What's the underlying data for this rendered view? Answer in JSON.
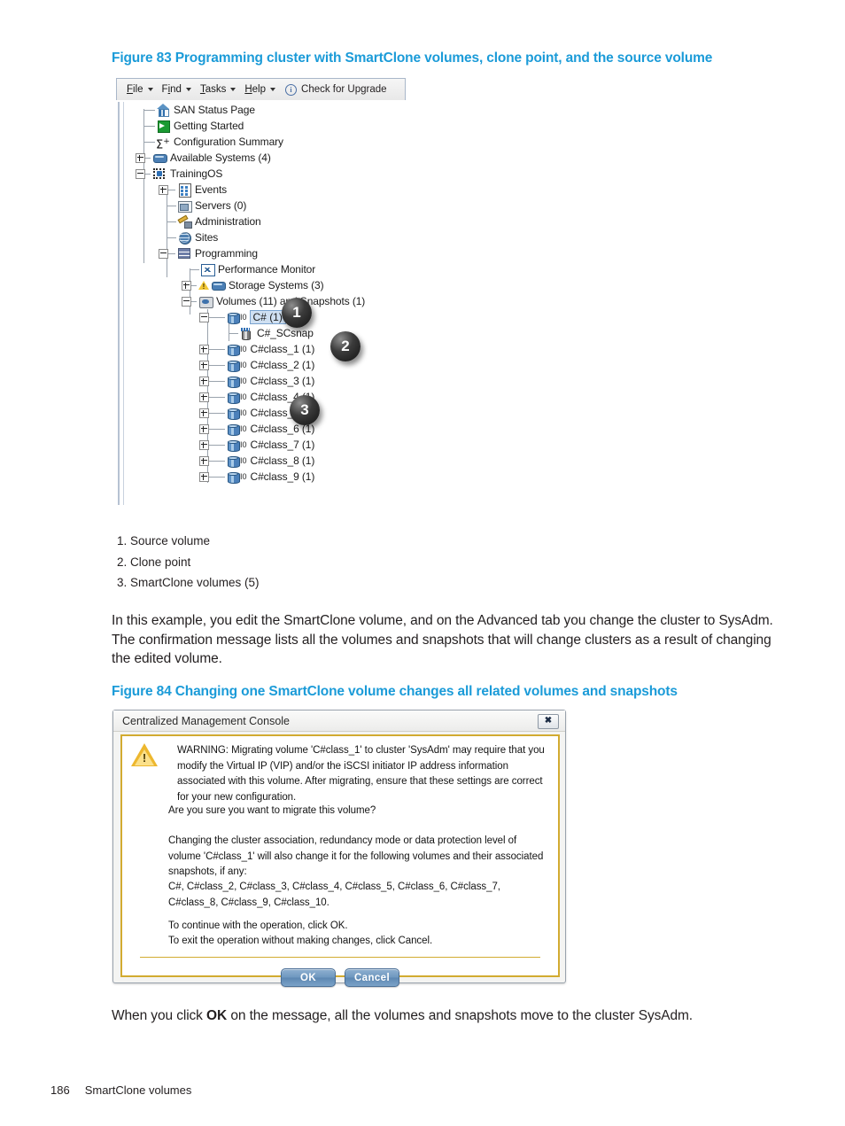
{
  "figure83": {
    "caption": "Figure 83 Programming cluster with SmartClone volumes, clone point, and the source volume",
    "menubar": {
      "items": [
        {
          "label": "File",
          "mnemonic": "F"
        },
        {
          "label": "Find",
          "mnemonic": "i"
        },
        {
          "label": "Tasks",
          "mnemonic": "T"
        },
        {
          "label": "Help",
          "mnemonic": "H"
        }
      ],
      "upgrade_label": "Check for Upgrade"
    },
    "tree": [
      {
        "label": "SAN Status Page",
        "icon": "home-icon",
        "indent": 0,
        "expander": "none"
      },
      {
        "label": "Getting Started",
        "icon": "green-arrow-icon",
        "indent": 0,
        "expander": "none"
      },
      {
        "label": "Configuration Summary",
        "icon": "sigma-icon",
        "indent": 0,
        "expander": "none"
      },
      {
        "label": "Available Systems (4)",
        "icon": "systems-icon",
        "indent": 0,
        "expander": "plus"
      },
      {
        "label": "TrainingOS",
        "icon": "os-icon",
        "indent": 0,
        "expander": "minus"
      },
      {
        "label": "Events",
        "icon": "events-icon",
        "indent": 1,
        "expander": "plus"
      },
      {
        "label": "Servers (0)",
        "icon": "servers-icon",
        "indent": 1,
        "expander": "none"
      },
      {
        "label": "Administration",
        "icon": "key-icon",
        "indent": 1,
        "expander": "none"
      },
      {
        "label": "Sites",
        "icon": "globe-icon",
        "indent": 1,
        "expander": "none"
      },
      {
        "label": "Programming",
        "icon": "cluster-icon",
        "indent": 1,
        "expander": "minus"
      },
      {
        "label": "Performance Monitor",
        "icon": "chart-icon",
        "indent": 2,
        "expander": "none"
      },
      {
        "label": "Storage Systems (3)",
        "icon": "warning-icon",
        "indent": 2,
        "expander": "plus"
      },
      {
        "label": "Volumes (11) and Snapshots (1)",
        "icon": "volumes-folder-icon",
        "indent": 2,
        "expander": "minus"
      },
      {
        "label": "C# (1)",
        "icon": "volume-icon",
        "indent": 3,
        "expander": "minus",
        "selected": true
      },
      {
        "label": "C#_SCsnap",
        "icon": "snapshot-icon",
        "indent": 4,
        "expander": "none"
      },
      {
        "label": "C#class_1 (1)",
        "icon": "volume-icon",
        "indent": 3,
        "expander": "plus"
      },
      {
        "label": "C#class_2 (1)",
        "icon": "volume-icon",
        "indent": 3,
        "expander": "plus"
      },
      {
        "label": "C#class_3 (1)",
        "icon": "volume-icon",
        "indent": 3,
        "expander": "plus"
      },
      {
        "label": "C#class_4 (1)",
        "icon": "volume-icon",
        "indent": 3,
        "expander": "plus"
      },
      {
        "label": "C#class_5 (1)",
        "icon": "volume-icon",
        "indent": 3,
        "expander": "plus"
      },
      {
        "label": "C#class_6 (1)",
        "icon": "volume-icon",
        "indent": 3,
        "expander": "plus"
      },
      {
        "label": "C#class_7 (1)",
        "icon": "volume-icon",
        "indent": 3,
        "expander": "plus"
      },
      {
        "label": "C#class_8 (1)",
        "icon": "volume-icon",
        "indent": 3,
        "expander": "plus"
      },
      {
        "label": "C#class_9 (1)",
        "icon": "volume-icon",
        "indent": 3,
        "expander": "plus"
      }
    ],
    "callouts": [
      "1",
      "2",
      "3"
    ],
    "legend": [
      "1. Source volume",
      "2. Clone point",
      "3. SmartClone volumes (5)"
    ]
  },
  "paragraph1": "In this example, you edit the SmartClone volume, and on the Advanced tab you change the cluster to SysAdm. The confirmation message lists all the volumes and snapshots that will change clusters as a result of changing the edited volume.",
  "figure84": {
    "caption": "Figure 84 Changing one SmartClone volume changes all related volumes and snapshots",
    "dialog": {
      "title": "Centralized Management Console",
      "close_glyph": "✖",
      "warning_icon": "warning-triangle-icon",
      "paragraph1": "WARNING: Migrating volume 'C#class_1' to cluster 'SysAdm' may require that you modify the Virtual IP (VIP) and/or the iSCSI initiator IP address information associated with this volume. After migrating, ensure that these settings are correct for your new configuration.",
      "paragraph2": "Are you sure you want to migrate this volume?",
      "paragraph3": "Changing the cluster association, redundancy mode or data protection level of volume 'C#class_1' will also change it for the following volumes and their associated snapshots, if any:",
      "volume_list": "C#, C#class_2, C#class_3, C#class_4, C#class_5, C#class_6, C#class_7, C#class_8, C#class_9, C#class_10.",
      "paragraph4": "To continue with the operation, click OK.",
      "paragraph5": "To exit the operation without making changes, click Cancel.",
      "ok_label": "OK",
      "cancel_label": "Cancel"
    }
  },
  "paragraph2_prefix": "When you click ",
  "paragraph2_bold": "OK",
  "paragraph2_suffix": " on the message, all the volumes and snapshots move to the cluster SysAdm.",
  "footer": {
    "page_number": "186",
    "section": "SmartClone volumes"
  }
}
